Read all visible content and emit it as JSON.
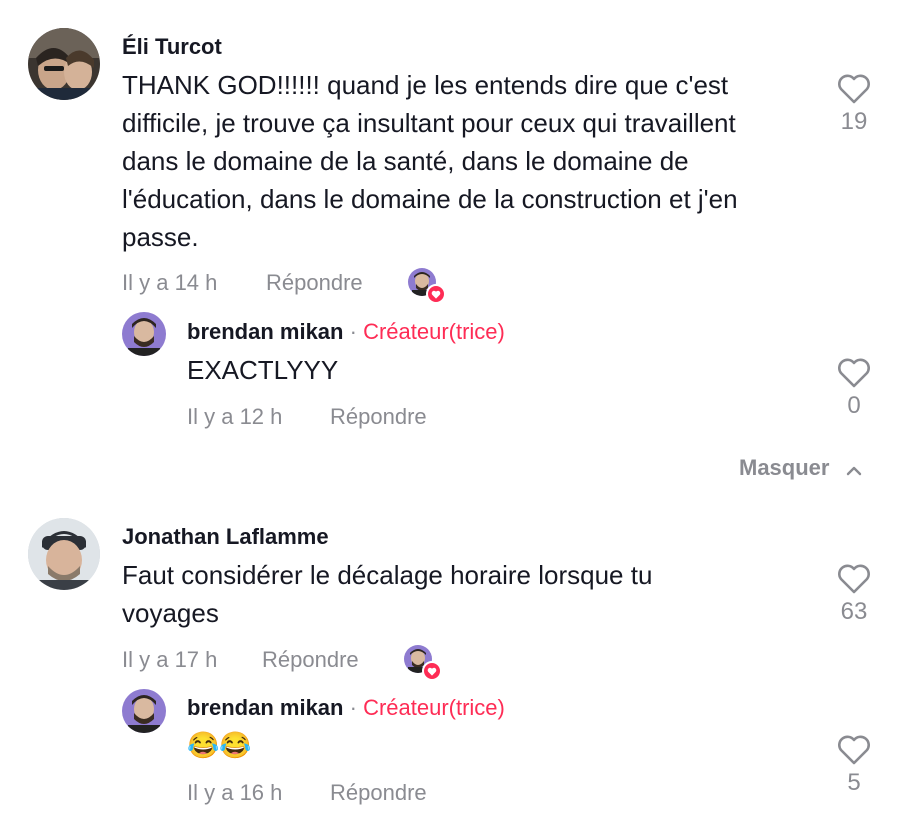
{
  "comments": [
    {
      "author": "Éli Turcot",
      "text": "THANK GOD!!!!!! quand je les entends dire que c'est difficile, je trouve ça insultant pour ceux qui travaillent dans le domaine de la santé, dans le domaine de l'éducation, dans le domaine de la construction et j'en passe.",
      "time": "Il y a 14 h",
      "reply_label": "Répondre",
      "likes": "19",
      "reply": {
        "author": "brendan mikan",
        "separator": "·",
        "badge": "Créateur(trice)",
        "text": "EXACTLYYY",
        "time": "Il y a 12 h",
        "reply_label": "Répondre",
        "likes": "0"
      }
    },
    {
      "author": "Jonathan Laflamme",
      "text": "Faut considérer le décalage horaire lorsque tu voyages",
      "time": "Il y a 17 h",
      "reply_label": "Répondre",
      "likes": "63",
      "reply": {
        "author": "brendan mikan",
        "separator": "·",
        "badge": "Créateur(trice)",
        "text": "😂😂",
        "time": "Il y a 16 h",
        "reply_label": "Répondre",
        "likes": "5"
      }
    }
  ],
  "hide_label": "Masquer",
  "colors": {
    "accent": "#fe2c55",
    "muted": "#8a8b91",
    "text": "#161823"
  }
}
